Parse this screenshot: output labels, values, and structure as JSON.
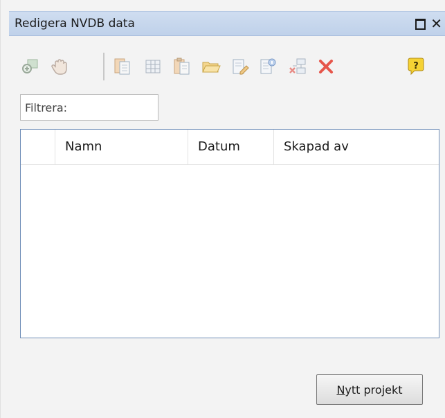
{
  "window": {
    "title": "Redigera NVDB data",
    "maximize_icon": "maximize-icon",
    "close_glyph": "✕"
  },
  "toolbar": {
    "icons": [
      "zoom-to-icon",
      "pan-hand-icon",
      "copy-document-icon",
      "table-icon",
      "paste-document-icon",
      "open-folder-icon",
      "edit-document-icon",
      "properties-document-icon",
      "network-delete-icon",
      "delete-icon",
      "help-icon"
    ]
  },
  "filter": {
    "placeholder": "Filtrera:",
    "value": ""
  },
  "grid": {
    "columns": [
      "",
      "Namn",
      "Datum",
      "Skapad av"
    ],
    "rows": []
  },
  "new_project_button": {
    "mnemonic": "N",
    "rest": "ytt projekt"
  },
  "colors": {
    "title_bar": "#c4d5ec",
    "grid_border": "#6f8db7",
    "panel_bg": "#f3f3f3",
    "delete_red": "#e6554a",
    "help_yellow": "#f5d234"
  }
}
